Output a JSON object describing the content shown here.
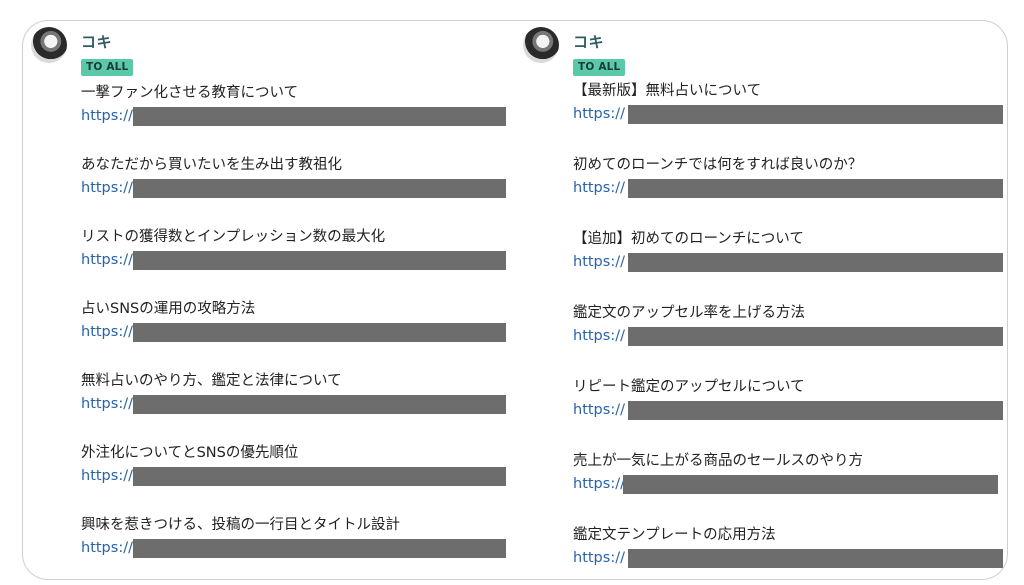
{
  "left_post": {
    "author": "コキ",
    "badge": "TO ALL",
    "items": [
      {
        "title": "一撃ファン化させる教育について",
        "link_prefix": "https://"
      },
      {
        "title": "あなただから買いたいを生み出す教祖化",
        "link_prefix": "https://"
      },
      {
        "title": "リストの獲得数とインプレッション数の最大化",
        "link_prefix": "https://"
      },
      {
        "title": "占いSNSの運用の攻略方法",
        "link_prefix": "https://"
      },
      {
        "title": "無料占いのやり方、鑑定と法律について",
        "link_prefix": "https://"
      },
      {
        "title": "外注化についてとSNSの優先順位",
        "link_prefix": "https://"
      },
      {
        "title": "興味を惹きつける、投稿の一行目とタイトル設計",
        "link_prefix": "https://"
      }
    ]
  },
  "right_post": {
    "author": "コキ",
    "badge": "TO ALL",
    "items": [
      {
        "title": "【最新版】無料占いについて",
        "link_prefix": "https://"
      },
      {
        "title": "初めてのローンチでは何をすれば良いのか？",
        "link_prefix": "https://"
      },
      {
        "title": "【追加】初めてのローンチについて",
        "link_prefix": "https://"
      },
      {
        "title": "鑑定文のアップセル率を上げる方法",
        "link_prefix": "https://"
      },
      {
        "title": "リピート鑑定のアップセルについて",
        "link_prefix": "https://"
      },
      {
        "title": "売上が一気に上がる商品のセールスのやり方",
        "link_prefix": "https://"
      },
      {
        "title": "鑑定文テンプレートの応用方法",
        "link_prefix": "https://"
      }
    ]
  },
  "colors": {
    "badge_bg": "#5ac9aa",
    "author": "#2f5d62",
    "link": "#2a62a8",
    "redaction": "#6d6d6d"
  }
}
